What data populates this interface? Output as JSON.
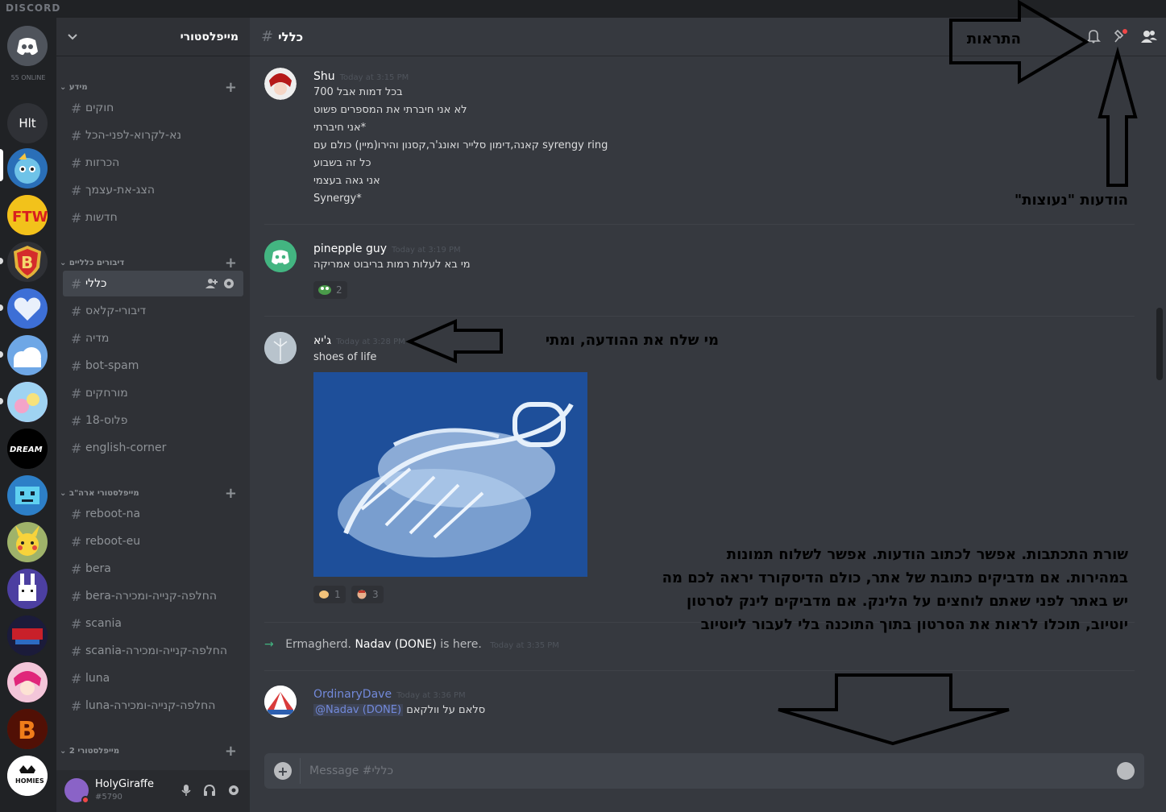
{
  "app": {
    "name": "DISCORD"
  },
  "guilds": {
    "online_count": "55 ONLINE",
    "hlt_label": "Hlt"
  },
  "server": {
    "name": "מייפלסטורי"
  },
  "categories": [
    {
      "name": "מידע"
    },
    {
      "name": "דיבורים כלליים"
    },
    {
      "name": "מייפלסטורי ארה\"ב"
    },
    {
      "name": "מייפלסטורי 2"
    }
  ],
  "channels": [
    {
      "name": "חוקים"
    },
    {
      "name": "נא-לקרוא-לפני-הכל"
    },
    {
      "name": "הכרזות"
    },
    {
      "name": "הצג-את-עצמך"
    },
    {
      "name": "חדשות"
    },
    {
      "name": "כללי"
    },
    {
      "name": "דיבורי-קלאס"
    },
    {
      "name": "מדיה"
    },
    {
      "name": "bot-spam"
    },
    {
      "name": "מורחקים"
    },
    {
      "name": "פלוס-18"
    },
    {
      "name": "english-corner"
    },
    {
      "name": "reboot-na"
    },
    {
      "name": "reboot-eu"
    },
    {
      "name": "bera"
    },
    {
      "name": "bera-החלפה-קנייה-ומכירה"
    },
    {
      "name": "scania"
    },
    {
      "name": "scania-החלפה-קנייה-ומכירה"
    },
    {
      "name": "luna"
    },
    {
      "name": "luna-החלפה-קנייה-ומכירה"
    }
  ],
  "user": {
    "name": "HolyGiraffe",
    "tag": "#5790"
  },
  "chat": {
    "channel_name": "כללי",
    "placeholder": "Message #כללי"
  },
  "messages": [
    {
      "author": "Shu",
      "timestamp": "Today at 3:15 PM",
      "lines": [
        "בכל דמות אבל 700",
        "לא אני חיברתי את המספרים פשוט",
        "אני חיברתי*",
        "קאנה,דימון סלייר ואונג'ר,קסנון והירו(מיין) כולם עם syrengy ring",
        "כל זה בשבוע",
        "אני גאה בעצמי",
        "Synergy*"
      ]
    },
    {
      "author": "pinepple guy",
      "timestamp": "Today at 3:19 PM",
      "lines": [
        "מי בא לעלות רמות בריבוט אמריקה"
      ],
      "reaction_count": "2"
    },
    {
      "author": "ג'יא",
      "timestamp": "Today at 3:28 PM",
      "lines": [
        "shoes of life"
      ],
      "reactions": [
        "1",
        "3"
      ]
    },
    {
      "author": "OrdinaryDave",
      "timestamp": "Today at 3:36 PM",
      "mention": "@Nadav (DONE)",
      "text": "סלאם על וולקאם"
    }
  ],
  "join": {
    "who": "Ermagherd.",
    "name": "Nadav (DONE)",
    "text": "is here.",
    "timestamp": "Today at 3:35 PM"
  },
  "annotations": {
    "notifications": "התראות",
    "pinned": "הודעות \"נעוצות\"",
    "sender": "מי שלח את ההודעה, ומתי",
    "composer_lines": [
      "שורת התכתבות. אפשר לכתוב הודעות. אפשר לשלוח תמונות",
      "במהירות. אם מדביקים כתובת של אתר, כולם הדיסקורד יראה לכם מה",
      "יש באתר לפני שאתם לוחצים על הלינק. אם מדביקים לינק לסרטון",
      "יוטיוב, תוכלו לראות את הסרטון בתוך התוכנה בלי לעבור ליוטיוב"
    ]
  },
  "colors": {
    "accent": "#7289da",
    "online": "#43b581",
    "dnd": "#f04747",
    "link": "#7289da"
  }
}
